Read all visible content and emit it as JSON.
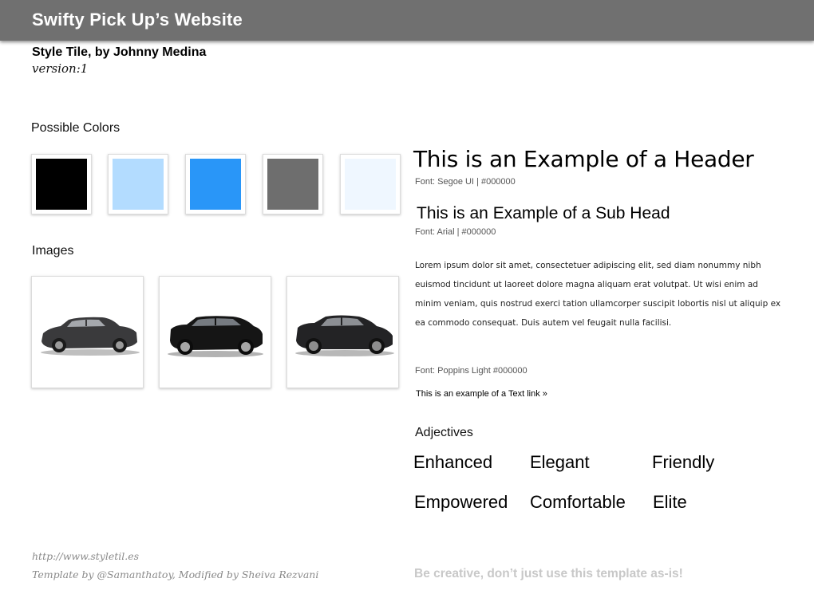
{
  "header": {
    "site_title": "Swifty Pick Up’s Website",
    "subtitle": "Style Tile, by Johnny Medina",
    "version": "version:1"
  },
  "colors": {
    "label": "Possible Colors",
    "swatches": [
      "#000000",
      "#b3dcff",
      "#2996f8",
      "#6e6e6e",
      "#eff7ff"
    ]
  },
  "images": {
    "label": "Images",
    "items": [
      {
        "name": "gray-suv-photo",
        "body_color": "#3a3a3c"
      },
      {
        "name": "black-suv-photo",
        "body_color": "#151515"
      },
      {
        "name": "dark-crossover-photo",
        "body_color": "#232325"
      }
    ]
  },
  "typography": {
    "header_example": "This is an Example of a Header",
    "header_font_note": "Font: Segoe UI |  #000000",
    "subhead_example": "This is an Example of a Sub Head",
    "subhead_font_note": "Font: Arial  |  #000000",
    "body_text": "Lorem ipsum dolor sit amet, consectetuer adipiscing elit, sed diam nonummy nibh euismod tincidunt ut laoreet dolore magna aliquam erat volutpat. Ut wisi enim ad minim veniam, quis nostrud exerci tation ullamcorper suscipit lobortis nisl ut aliquip ex ea commodo consequat. Duis autem vel feugait nulla facilisi.",
    "body_font_note": "Font: Poppins Light #000000",
    "text_link": "This is an example of a Text link »"
  },
  "adjectives": {
    "label": "Adjectives",
    "items": [
      "Enhanced",
      "Elegant",
      "Friendly",
      "Empowered",
      "Comfortable",
      "Elite"
    ]
  },
  "footer": {
    "url": "http://www.styletil.es",
    "credit": "Template by @Samanthatoy, Modified by Sheiva Rezvani",
    "note": "Be creative, don’t just use this template as-is!"
  }
}
